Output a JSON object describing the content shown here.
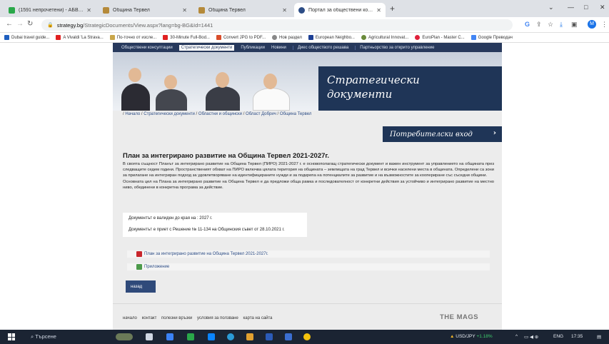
{
  "tabs": [
    {
      "label": "(1591 непрочетени) - АБВ поща",
      "active": false
    },
    {
      "label": "Община Тервел",
      "active": false
    },
    {
      "label": "Община Тервел",
      "active": false
    },
    {
      "label": "Портал за обществени консулт...",
      "active": true
    }
  ],
  "address": {
    "host": "strategy.bg",
    "path": "/StrategicDocuments/View.aspx?lang=bg-BG&Id=1441"
  },
  "profile_initial": "M",
  "bookmarks": [
    "Dubai travel guide...",
    "A Vivaldi 'La Strava...",
    "По-точно от изсле...",
    "30-Minute Full-Bod...",
    "Convert JPG to PDF...",
    "Нов раздел",
    "European Neighbo...",
    "Agricultural Innovat...",
    "EuroPlan - Master C...",
    "Google Преводач"
  ],
  "site": {
    "nav": [
      "Обществени консултации",
      "Стратегически документи",
      "Публикации",
      "Новини",
      "Диес обществото решава",
      "Партньорство за открито управление"
    ],
    "banner_title_1": "Стратегически",
    "banner_title_2": "документи",
    "breadcrumbs": [
      "Начало",
      "Стратегически документи",
      "Областни и общински",
      "Област Добрич",
      "Община Тервел"
    ],
    "login_label": "Потребителски вход",
    "doc_title": "План за интегрирано развитие на Община Тервел 2021-2027г.",
    "desc_p1": "В своята същност Планът за интегрирано развитие на Община Тервел (ПИРО) 2021-2027 г. е основополагащ стратегически документ и важен инструмент за управлението на общината през следващите седем години. Пространственият обхват на ПИРО включва цялата територия на общината – землищата на град Тервел и всички населени места в общината. Определени са зони за прилагане на интегриран подход за удовлетворяване на идентифицираните нужди и за подкрепа на потенциалите за развитие и на възможностите за коопериране със съседни общини.",
    "desc_p2": "Основната цел на Плана за интегрирано развитие на Община Тервел е да предложи обща рамка и последователност от конкретни действия за устойчиво и интегрирано развитие на местно ниво, обединени в конкретна програма за действие.",
    "valid_until": "Документът е валиден до края на : 2027 г.",
    "adopted": "Документът е приет с Решение № 11-134 на Общинския съвет от 28.10.2021 г.",
    "files": [
      "План за интегрирано развитие на Община Тервел 2021-2027г.",
      "Приложение"
    ],
    "back_label": "назад",
    "footer_links": [
      "начало",
      "контакт",
      "полезни връзки",
      "условия за ползване",
      "карта на сайта"
    ],
    "footer_logo": "THE MAGS"
  },
  "taskbar": {
    "search": "Търсене",
    "ticker": "USD/JPY",
    "ticker_change": "+1.18%",
    "lang": "ENG",
    "time": "17:35"
  },
  "colors": {
    "navy": "#1f3557",
    "nav_bar": "#27395c",
    "link": "#2d4d86",
    "ticker_up": "#3ecf6e"
  }
}
